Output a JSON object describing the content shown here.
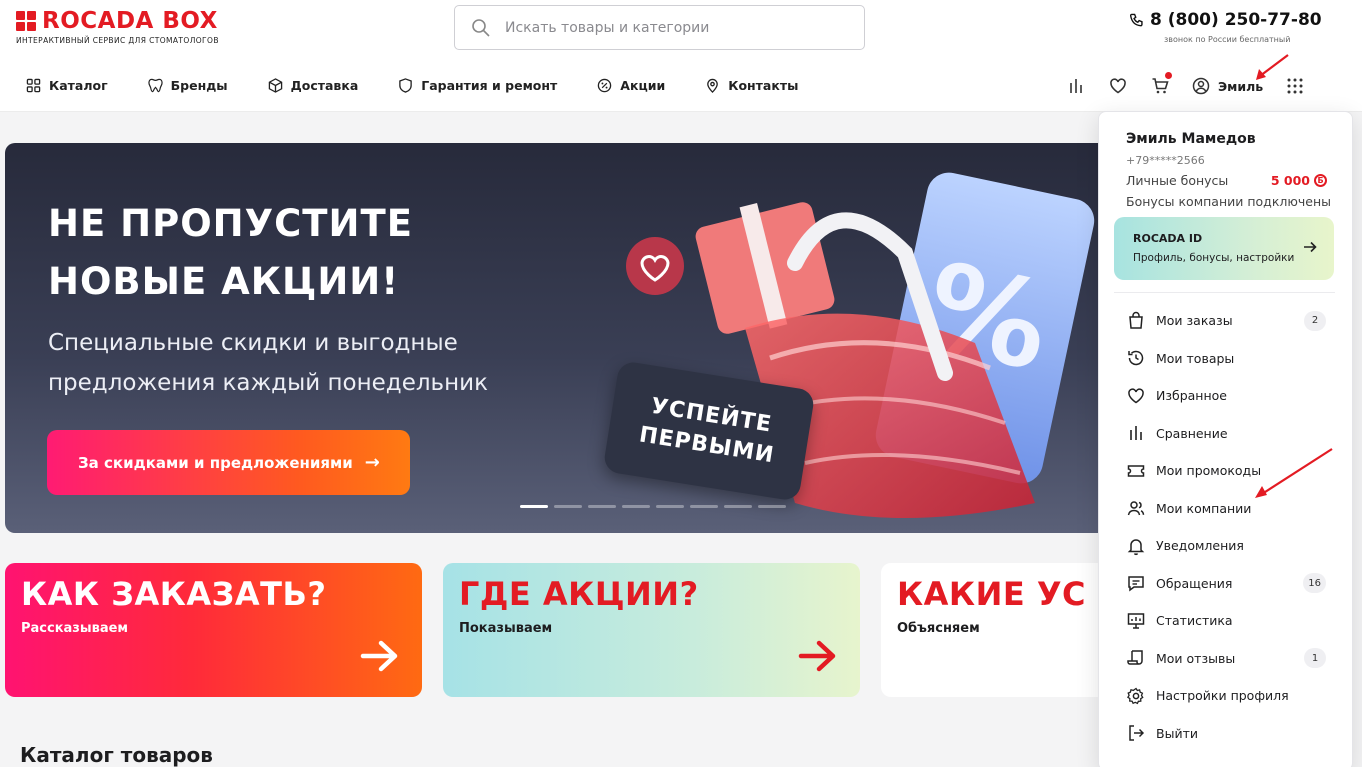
{
  "header": {
    "logo_name": "ROCADA BOX",
    "logo_tagline": "ИНТЕРАКТИВНЫЙ СЕРВИС ДЛЯ СТОМАТОЛОГОВ",
    "search_placeholder": "Искать товары и категории",
    "phone": "8 (800) 250-77-80",
    "phone_note": "звонок по России бесплатный",
    "user_name": "Эмиль"
  },
  "nav": [
    {
      "label": "Каталог",
      "icon": "grid-icon"
    },
    {
      "label": "Бренды",
      "icon": "tooth-icon"
    },
    {
      "label": "Доставка",
      "icon": "box-icon"
    },
    {
      "label": "Гарантия и ремонт",
      "icon": "shield-icon"
    },
    {
      "label": "Акции",
      "icon": "percent-badge-icon"
    },
    {
      "label": "Контакты",
      "icon": "location-pin-icon"
    }
  ],
  "banner": {
    "title_line1": "НЕ ПРОПУСТИТЕ",
    "title_line2": "НОВЫЕ АКЦИИ!",
    "subtitle_line1": "Специальные скидки и выгодные",
    "subtitle_line2": "предложения каждый понедельник",
    "button_label": "За скидками и предложениями",
    "stamp_line1": "УСПЕЙТЕ",
    "stamp_line2": "ПЕРВЫМИ",
    "slides_total": 8,
    "active_slide": 1
  },
  "cards": [
    {
      "title": "КАК ЗАКАЗАТЬ?",
      "subtitle": "Рассказываем"
    },
    {
      "title": "ГДЕ АКЦИИ?",
      "subtitle": "Показываем"
    },
    {
      "title": "КАКИЕ УС",
      "subtitle": "Объясняем"
    }
  ],
  "catalog_title": "Каталог товаров",
  "user_menu": {
    "full_name": "Эмиль Мамедов",
    "phone": "+79*****2566",
    "bonus_label": "Личные бонусы",
    "bonus_value": "5 000",
    "company_bonus": "Бонусы компании подключены",
    "rocada_id_title": "ROCADA ID",
    "rocada_id_sub": "Профиль, бонусы, настройки",
    "items": [
      {
        "label": "Мои заказы",
        "icon": "shopping-bag-icon",
        "badge": "2"
      },
      {
        "label": "Мои товары",
        "icon": "history-icon",
        "badge": ""
      },
      {
        "label": "Избранное",
        "icon": "heart-icon",
        "badge": ""
      },
      {
        "label": "Сравнение",
        "icon": "compare-bars-icon",
        "badge": ""
      },
      {
        "label": "Мои промокоды",
        "icon": "ticket-icon",
        "badge": ""
      },
      {
        "label": "Мои компании",
        "icon": "users-icon",
        "badge": ""
      },
      {
        "label": "Уведомления",
        "icon": "bell-icon",
        "badge": ""
      },
      {
        "label": "Обращения",
        "icon": "message-icon",
        "badge": "16"
      },
      {
        "label": "Статистика",
        "icon": "chart-board-icon",
        "badge": ""
      },
      {
        "label": "Мои отзывы",
        "icon": "review-icon",
        "badge": "1"
      },
      {
        "label": "Настройки профиля",
        "icon": "gear-icon",
        "badge": ""
      },
      {
        "label": "Выйти",
        "icon": "logout-icon",
        "badge": ""
      }
    ]
  },
  "colors": {
    "brand_red": "#e31b23",
    "banner_bg": "#2a2e40",
    "accent_gradient_start": "#ff1b73",
    "accent_gradient_end": "#ff7a12"
  }
}
